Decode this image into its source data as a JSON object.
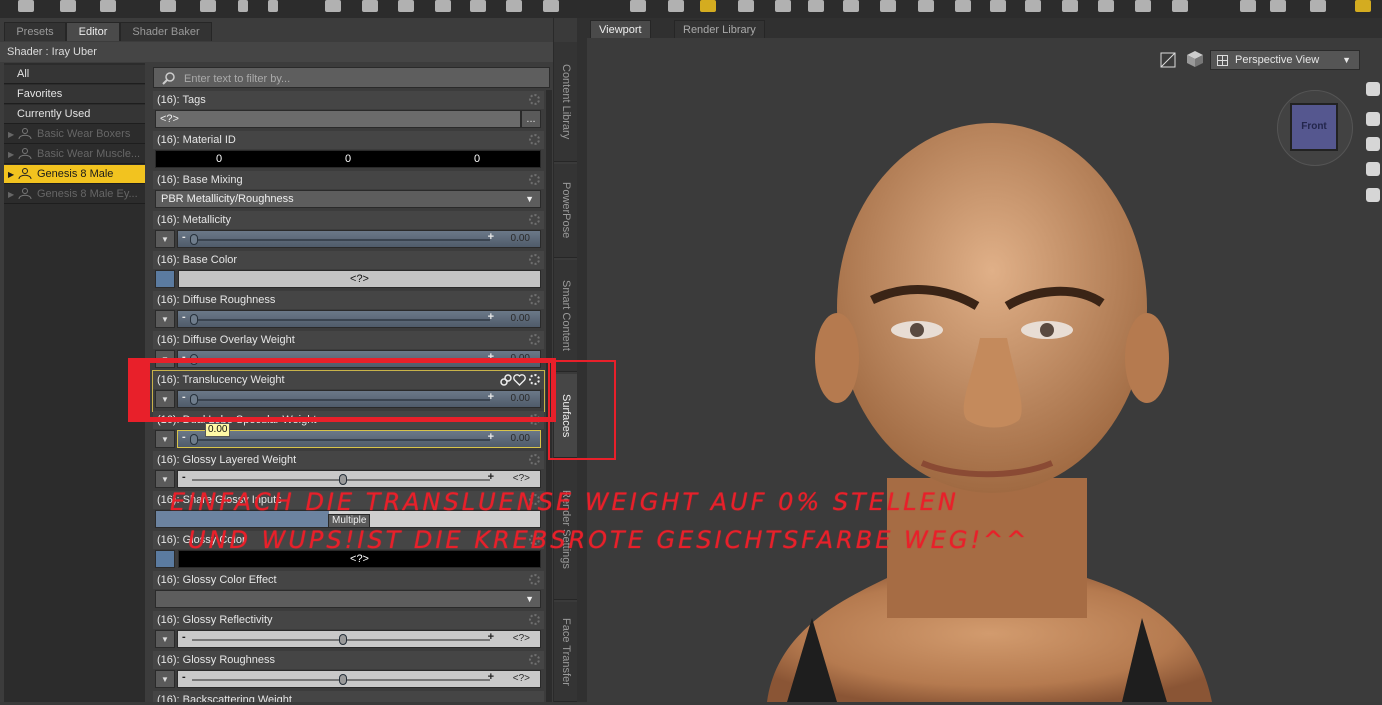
{
  "left_tabs": [
    "Presets",
    "Editor",
    "Shader Baker"
  ],
  "shader_label": "Shader : Iray Uber",
  "categories": [
    "All",
    "Favorites",
    "Currently Used"
  ],
  "materials": [
    {
      "label": "Basic Wear Boxers",
      "selected": false
    },
    {
      "label": "Basic Wear Muscle...",
      "selected": false
    },
    {
      "label": "Genesis 8 Male",
      "selected": true
    },
    {
      "label": "Genesis 8 Male Ey...",
      "selected": false
    }
  ],
  "filter_placeholder": "Enter text to filter by...",
  "properties": {
    "tags": {
      "title": "(16): Tags",
      "value": "<?>",
      "more": "..."
    },
    "material_id": {
      "title": "(16): Material ID",
      "values": [
        "0",
        "0",
        "0"
      ]
    },
    "base_mixing": {
      "title": "(16): Base Mixing",
      "value": "PBR Metallicity/Roughness"
    },
    "metallicity": {
      "title": "(16): Metallicity",
      "value": "0.00",
      "fraction": 0.0
    },
    "base_color": {
      "title": "(16): Base Color",
      "value": "<?>"
    },
    "diffuse_roughness": {
      "title": "(16): Diffuse Roughness",
      "value": "0.00",
      "fraction": 0.0
    },
    "diffuse_overlay_weight": {
      "title": "(16): Diffuse Overlay Weight",
      "value": "0.00",
      "fraction": 0.0
    },
    "translucency_weight": {
      "title": "(16): Translucency Weight",
      "value": "0.00",
      "fraction": 0.0
    },
    "dual_lobe": {
      "title": "(16): Dual Lobe Specular Weight",
      "value": "0.00",
      "fraction": 0.0,
      "tooltip": "0.00"
    },
    "glossy_layered_weight": {
      "title": "(16): Glossy Layered Weight",
      "value": "<?>",
      "fraction": 0.5
    },
    "share_glossy_inputs": {
      "title": "(16): Share Glossy Inputs",
      "tooltip": "Multiple"
    },
    "glossy_color": {
      "title": "(16): Glossy Color",
      "value": "<?>"
    },
    "glossy_color_effect": {
      "title": "(16): Glossy Color Effect",
      "value": ""
    },
    "glossy_reflectivity": {
      "title": "(16): Glossy Reflectivity",
      "value": "<?>",
      "fraction": 0.5
    },
    "glossy_roughness": {
      "title": "(16): Glossy Roughness",
      "value": "<?>",
      "fraction": 0.5
    },
    "backscattering_weight": {
      "title": "(16): Backscattering Weight"
    }
  },
  "side_tabs": [
    "Content Library",
    "PowerPose",
    "Smart Content",
    "Surfaces",
    "Render Settings",
    "Face Transfer"
  ],
  "viewport_tabs": [
    "Viewport",
    "Render Library"
  ],
  "view_mode": "Perspective View",
  "cube_label": "Front",
  "annotation": {
    "line1": "EINFACH DIE TRANSLUENSE WEIGHT AUF 0% STELLEN",
    "line2": "UND WUPS!IST DIE KREBSROTE GESICHTSFARBE WEG!^^"
  },
  "colors": {
    "selection": "#f2c31f",
    "annotation_red": "#e8202a",
    "cube": "#55578f"
  },
  "icons": [
    "figure-icon",
    "search-icon",
    "gear-icon",
    "link-icon",
    "heart-icon",
    "dropdown-arrow-icon",
    "camera-icon",
    "rotate-icon",
    "zoom-icon",
    "pan-icon"
  ]
}
